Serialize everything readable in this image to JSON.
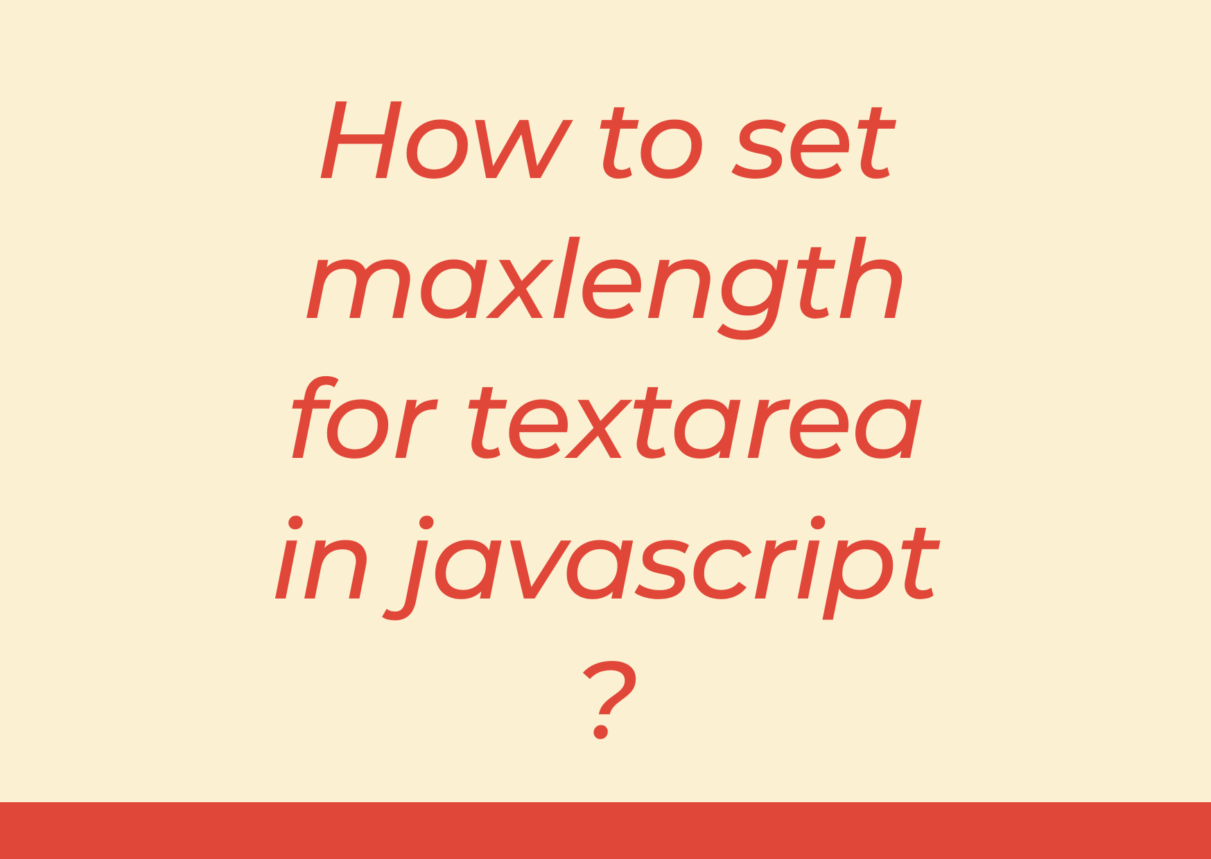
{
  "title": {
    "line1": "How to set",
    "line2": "maxlength",
    "line3": "for textarea",
    "line4": "in javascript",
    "line5": "?"
  },
  "colors": {
    "background": "#fbf0d2",
    "accent": "#e14738"
  }
}
